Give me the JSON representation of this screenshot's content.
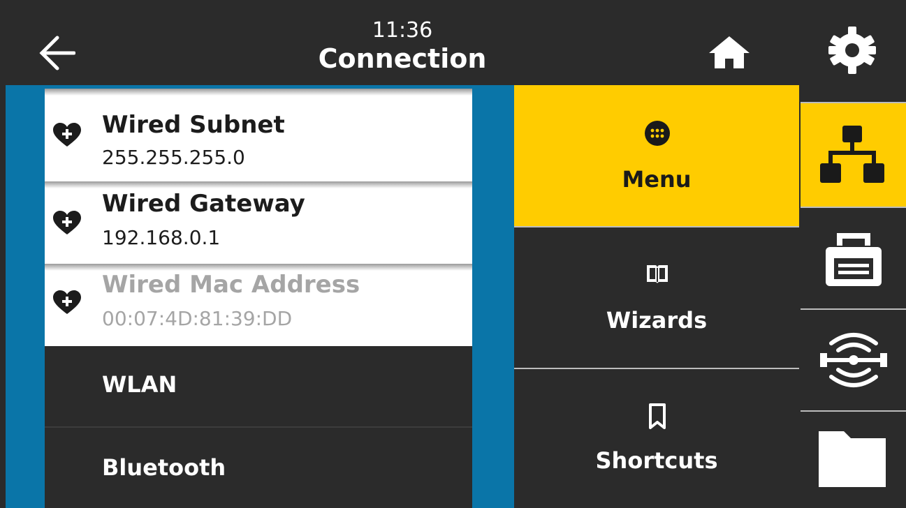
{
  "header": {
    "time": "11:36",
    "title": "Connection",
    "back_icon": "arrow-left-icon",
    "home_icon": "home-icon"
  },
  "list": {
    "items": [
      {
        "title": "Wired Subnet",
        "value": "255.255.255.0",
        "icon": "heart-plus-icon",
        "enabled": true
      },
      {
        "title": "Wired Gateway",
        "value": "192.168.0.1",
        "icon": "heart-plus-icon",
        "enabled": true
      },
      {
        "title": "Wired Mac Address",
        "value": "00:07:4D:81:39:DD",
        "icon": "heart-plus-icon",
        "enabled": false
      }
    ],
    "sections": [
      {
        "label": "WLAN"
      },
      {
        "label": "Bluetooth"
      }
    ]
  },
  "tiles": [
    {
      "label": "Menu",
      "icon": "grid-dots-icon",
      "active": true
    },
    {
      "label": "Wizards",
      "icon": "book-icon",
      "active": false
    },
    {
      "label": "Shortcuts",
      "icon": "bookmark-icon",
      "active": false
    }
  ],
  "rail": {
    "items": [
      {
        "icon": "gear-icon",
        "active": false
      },
      {
        "icon": "network-icon",
        "active": true
      },
      {
        "icon": "printer-icon",
        "active": false
      },
      {
        "icon": "rfid-icon",
        "active": false
      },
      {
        "icon": "folder-icon",
        "active": false
      }
    ]
  },
  "colors": {
    "accent": "#ffcc00",
    "dark": "#2b2b2b",
    "blue": "#0a75a8"
  }
}
